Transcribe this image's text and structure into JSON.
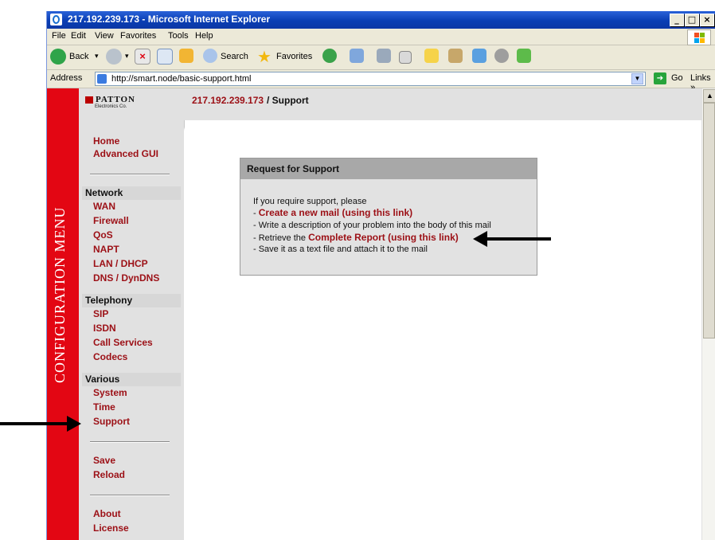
{
  "window": {
    "title": "217.192.239.173 - Microsoft Internet Explorer",
    "min": "_",
    "max": "□",
    "close": "×"
  },
  "menu": [
    "File",
    "Edit",
    "View",
    "Favorites",
    "Tools",
    "Help"
  ],
  "toolbar": {
    "back": "Back",
    "search": "Search",
    "favorites": "Favorites"
  },
  "address": {
    "label": "Address",
    "url": "http://smart.node/basic-support.html",
    "go": "Go",
    "links": "Links »"
  },
  "brand": {
    "side_banner": "CONFIGURATION MENU",
    "logo_text": "PATTON",
    "logo_sub": "Electronics Co."
  },
  "sidebar": {
    "top": [
      "Home",
      "Advanced GUI"
    ],
    "network_header": "Network",
    "network": [
      "WAN",
      "Firewall",
      "QoS",
      "NAPT",
      "LAN / DHCP",
      "DNS / DynDNS"
    ],
    "telephony_header": "Telephony",
    "telephony": [
      "SIP",
      "ISDN",
      "Call Services",
      "Codecs"
    ],
    "various_header": "Various",
    "various": [
      "System",
      "Time",
      "Support"
    ],
    "actions": [
      "Save",
      "Reload"
    ],
    "info": [
      "About",
      "License"
    ]
  },
  "header": {
    "ip": "217.192.239.173",
    "sep_page": "/ Support"
  },
  "support": {
    "title": "Request for Support",
    "intro": "If you require support, please",
    "step1_prefix": "- ",
    "step1_link": "Create a new mail (using this link)",
    "step2": "- Write a description of your problem into the body of this mail",
    "step3_prefix": "- Retrieve the ",
    "step3_link": "Complete Report (using this link)",
    "step4": "- Save it as a text file and attach it to the mail"
  },
  "colors": {
    "accent_red": "#e30613",
    "link": "#9c1016",
    "xp_blue": "#0a3eb4"
  }
}
